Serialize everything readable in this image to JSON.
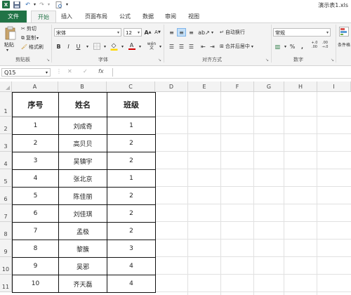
{
  "titlebar": {
    "app_icon": "X",
    "filename": "演示表1.xls",
    "icons": [
      "excel-logo-icon",
      "save-icon",
      "undo-icon",
      "redo-icon",
      "customize-icon"
    ]
  },
  "tabs": [
    "文件",
    "开始",
    "插入",
    "页面布局",
    "公式",
    "数据",
    "审阅",
    "视图"
  ],
  "active_tab": "开始",
  "ribbon": {
    "clipboard": {
      "paste": "粘贴",
      "cut": "剪切",
      "copy": "复制",
      "format_painter": "格式刷",
      "label": "剪贴板"
    },
    "font": {
      "name": "宋体",
      "size": "12",
      "grow": "A",
      "shrink": "A",
      "bold": "B",
      "italic": "I",
      "underline": "U",
      "font_color_sample": "A",
      "wen": "wén",
      "label": "字体"
    },
    "alignment": {
      "wrap": "自动换行",
      "merge": "合并后居中",
      "label": "对齐方式"
    },
    "number": {
      "format": "常规",
      "percent": "%",
      "comma": ",",
      "inc_decimal": "+.0 .00",
      "dec_decimal": ".00 →.0",
      "label": "数字"
    },
    "styles": {
      "cond": "条件格"
    }
  },
  "formula_bar": {
    "name_box": "Q15",
    "cancel": "✕",
    "enter": "✓",
    "fx": "fx",
    "value": ""
  },
  "columns": [
    "A",
    "B",
    "C",
    "D",
    "E",
    "F",
    "G",
    "H",
    "I"
  ],
  "rows": [
    "1",
    "2",
    "3",
    "4",
    "5",
    "6",
    "7",
    "8",
    "9",
    "10",
    "11"
  ],
  "table": {
    "headers": [
      "序号",
      "姓名",
      "班级"
    ],
    "rows": [
      [
        "1",
        "刘成奇",
        "1"
      ],
      [
        "2",
        "高贝贝",
        "2"
      ],
      [
        "3",
        "吴镇宇",
        "2"
      ],
      [
        "4",
        "张北京",
        "1"
      ],
      [
        "5",
        "陈佳丽",
        "2"
      ],
      [
        "6",
        "刘佳琪",
        "2"
      ],
      [
        "7",
        "孟极",
        "2"
      ],
      [
        "8",
        "黎簇",
        "3"
      ],
      [
        "9",
        "吴邪",
        "4"
      ],
      [
        "10",
        "齐天磊",
        "4"
      ]
    ]
  },
  "colors": {
    "brand": "#217346",
    "selected": "#c5e0f7",
    "header_bg": "#f3f3f3",
    "gridline": "#e1e1e1",
    "font_red": "#d00000",
    "fill_yellow": "#ffd800"
  }
}
